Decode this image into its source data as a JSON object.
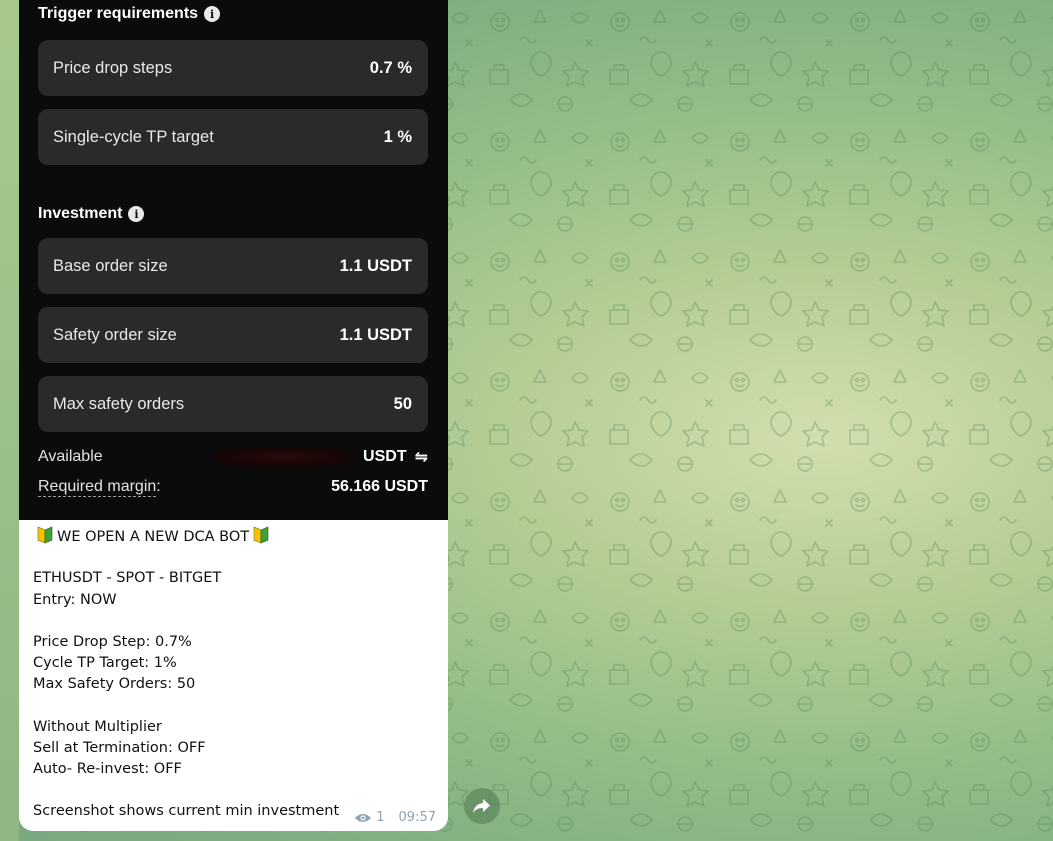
{
  "screenshot": {
    "trigger_section": {
      "title": "Trigger requirements"
    },
    "trigger_items": [
      {
        "label": "Price drop steps",
        "value": "0.7 %"
      },
      {
        "label": "Single-cycle TP target",
        "value": "1 %"
      }
    ],
    "investment_section": {
      "title": "Investment"
    },
    "investment_items": [
      {
        "label": "Base order size",
        "value": "1.1 USDT"
      },
      {
        "label": "Safety order size",
        "value": "1.1 USDT"
      },
      {
        "label": "Max safety orders",
        "value": "50"
      }
    ],
    "available": {
      "label": "Available",
      "currency": "USDT"
    },
    "required_margin": {
      "label": "Required margin",
      "separator": ":",
      "value": "56.166 USDT"
    }
  },
  "message": {
    "headline": "WE OPEN A NEW DCA BOT",
    "lines": [
      "ETHUSDT - SPOT - BITGET",
      "Entry: NOW",
      "Price Drop Step: 0.7%",
      "Cycle TP Target: 1%",
      "Max Safety Orders: 50",
      "Without Multiplier",
      "Sell at Termination: OFF",
      "Auto- Re-invest: OFF",
      "Screenshot shows current min investment"
    ],
    "views": "1",
    "time": "09:57"
  },
  "icons": {
    "info": "info-icon",
    "swap": "swap-arrows-icon",
    "badge": "beginner-badge-icon",
    "views": "eye-icon",
    "forward": "forward-arrow-icon"
  },
  "colors": {
    "screenshot_bg": "#0b0b0c",
    "card_bg": "#2a2a2d",
    "bubble_bg": "#ffffff",
    "meta_text": "#8fa2b0",
    "badge_green": "#3fa03a",
    "badge_yellow": "#f5c400"
  }
}
